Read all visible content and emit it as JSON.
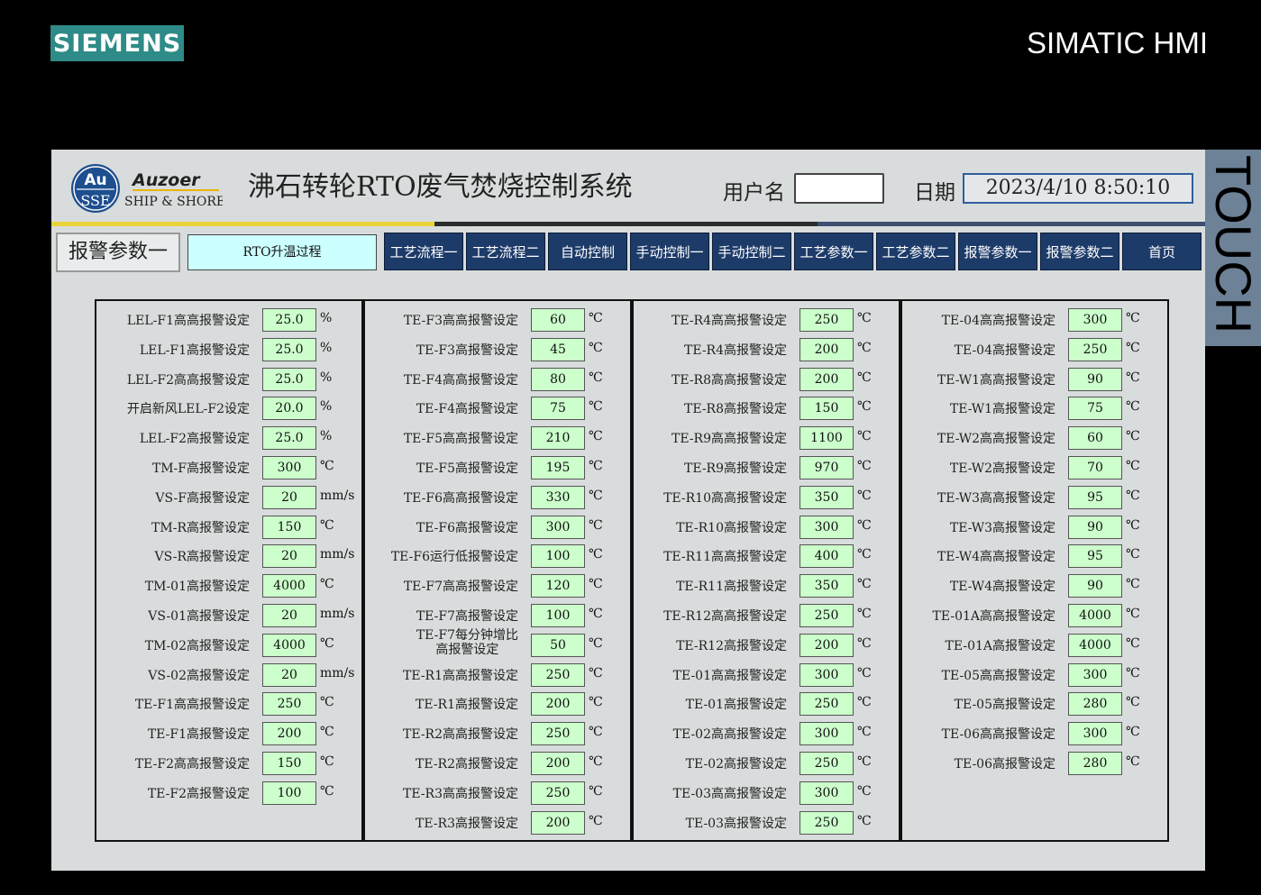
{
  "frame": {
    "brand": "SIEMENS",
    "product": "SIMATIC HMI",
    "touch_label": "TOUCH"
  },
  "logo": {
    "au": "Au",
    "sse": "SSE",
    "brand": "Auzoer",
    "sub": "SHIP & SHORE"
  },
  "header": {
    "title": "沸石转轮RTO废气焚烧控制系统",
    "user_label": "用户名",
    "user_value": "",
    "date_label": "日期",
    "datetime": "2023/4/10 8:50:10"
  },
  "page_label": "报警参数一",
  "stage": "RTO升温过程",
  "nav": [
    "工艺流程一",
    "工艺流程二",
    "自动控制",
    "手动控制一",
    "手动控制二",
    "工艺参数一",
    "工艺参数二",
    "报警参数一",
    "报警参数二",
    "首页"
  ],
  "columns": [
    [
      {
        "label": "LEL-F1高高报警设定",
        "value": "25.0",
        "unit": "%"
      },
      {
        "label": "LEL-F1高报警设定",
        "value": "25.0",
        "unit": "%"
      },
      {
        "label": "LEL-F2高高报警设定",
        "value": "25.0",
        "unit": "%"
      },
      {
        "label": "开启新风LEL-F2设定",
        "value": "20.0",
        "unit": "%"
      },
      {
        "label": "LEL-F2高报警设定",
        "value": "25.0",
        "unit": "%"
      },
      {
        "label": "TM-F高报警设定",
        "value": "300",
        "unit": "℃"
      },
      {
        "label": "VS-F高报警设定",
        "value": "20",
        "unit": "mm/s"
      },
      {
        "label": "TM-R高报警设定",
        "value": "150",
        "unit": "℃"
      },
      {
        "label": "VS-R高报警设定",
        "value": "20",
        "unit": "mm/s"
      },
      {
        "label": "TM-01高报警设定",
        "value": "4000",
        "unit": "℃"
      },
      {
        "label": "VS-01高报警设定",
        "value": "20",
        "unit": "mm/s"
      },
      {
        "label": "TM-02高报警设定",
        "value": "4000",
        "unit": "℃"
      },
      {
        "label": "VS-02高报警设定",
        "value": "20",
        "unit": "mm/s"
      },
      {
        "label": "TE-F1高高报警设定",
        "value": "250",
        "unit": "℃"
      },
      {
        "label": "TE-F1高报警设定",
        "value": "200",
        "unit": "℃"
      },
      {
        "label": "TE-F2高高报警设定",
        "value": "150",
        "unit": "℃"
      },
      {
        "label": "TE-F2高报警设定",
        "value": "100",
        "unit": "℃"
      }
    ],
    [
      {
        "label": "TE-F3高高报警设定",
        "value": "60",
        "unit": "℃"
      },
      {
        "label": "TE-F3高报警设定",
        "value": "45",
        "unit": "℃"
      },
      {
        "label": "TE-F4高高报警设定",
        "value": "80",
        "unit": "℃"
      },
      {
        "label": "TE-F4高报警设定",
        "value": "75",
        "unit": "℃"
      },
      {
        "label": "TE-F5高高报警设定",
        "value": "210",
        "unit": "℃"
      },
      {
        "label": "TE-F5高报警设定",
        "value": "195",
        "unit": "℃"
      },
      {
        "label": "TE-F6高高报警设定",
        "value": "330",
        "unit": "℃"
      },
      {
        "label": "TE-F6高报警设定",
        "value": "300",
        "unit": "℃"
      },
      {
        "label": "TE-F6运行低报警设定",
        "value": "100",
        "unit": "℃"
      },
      {
        "label": "TE-F7高高报警设定",
        "value": "120",
        "unit": "℃"
      },
      {
        "label": "TE-F7高报警设定",
        "value": "100",
        "unit": "℃"
      },
      {
        "label": "TE-F7每分钟增比\n高报警设定",
        "value": "50",
        "unit": "℃"
      },
      {
        "label": "TE-R1高高报警设定",
        "value": "250",
        "unit": "℃"
      },
      {
        "label": "TE-R1高报警设定",
        "value": "200",
        "unit": "℃"
      },
      {
        "label": "TE-R2高高报警设定",
        "value": "250",
        "unit": "℃"
      },
      {
        "label": "TE-R2高报警设定",
        "value": "200",
        "unit": "℃"
      },
      {
        "label": "TE-R3高高报警设定",
        "value": "250",
        "unit": "℃"
      },
      {
        "label": "TE-R3高报警设定",
        "value": "200",
        "unit": "℃"
      }
    ],
    [
      {
        "label": "TE-R4高高报警设定",
        "value": "250",
        "unit": "℃"
      },
      {
        "label": "TE-R4高报警设定",
        "value": "200",
        "unit": "℃"
      },
      {
        "label": "TE-R8高高报警设定",
        "value": "200",
        "unit": "℃"
      },
      {
        "label": "TE-R8高报警设定",
        "value": "150",
        "unit": "℃"
      },
      {
        "label": "TE-R9高高报警设定",
        "value": "1100",
        "unit": "℃"
      },
      {
        "label": "TE-R9高报警设定",
        "value": "970",
        "unit": "℃"
      },
      {
        "label": "TE-R10高高报警设定",
        "value": "350",
        "unit": "℃"
      },
      {
        "label": "TE-R10高报警设定",
        "value": "300",
        "unit": "℃"
      },
      {
        "label": "TE-R11高高报警设定",
        "value": "400",
        "unit": "℃"
      },
      {
        "label": "TE-R11高报警设定",
        "value": "350",
        "unit": "℃"
      },
      {
        "label": "TE-R12高高报警设定",
        "value": "250",
        "unit": "℃"
      },
      {
        "label": "TE-R12高报警设定",
        "value": "200",
        "unit": "℃"
      },
      {
        "label": "TE-01高高报警设定",
        "value": "300",
        "unit": "℃"
      },
      {
        "label": "TE-01高报警设定",
        "value": "250",
        "unit": "℃"
      },
      {
        "label": "TE-02高高报警设定",
        "value": "300",
        "unit": "℃"
      },
      {
        "label": "TE-02高报警设定",
        "value": "250",
        "unit": "℃"
      },
      {
        "label": "TE-03高高报警设定",
        "value": "300",
        "unit": "℃"
      },
      {
        "label": "TE-03高报警设定",
        "value": "250",
        "unit": "℃"
      }
    ],
    [
      {
        "label": "TE-04高高报警设定",
        "value": "300",
        "unit": "℃"
      },
      {
        "label": "TE-04高报警设定",
        "value": "250",
        "unit": "℃"
      },
      {
        "label": "TE-W1高高报警设定",
        "value": "90",
        "unit": "℃"
      },
      {
        "label": "TE-W1高报警设定",
        "value": "75",
        "unit": "℃"
      },
      {
        "label": "TE-W2高高报警设定",
        "value": "60",
        "unit": "℃"
      },
      {
        "label": "TE-W2高报警设定",
        "value": "70",
        "unit": "℃"
      },
      {
        "label": "TE-W3高高报警设定",
        "value": "95",
        "unit": "℃"
      },
      {
        "label": "TE-W3高报警设定",
        "value": "90",
        "unit": "℃"
      },
      {
        "label": "TE-W4高高报警设定",
        "value": "95",
        "unit": "℃"
      },
      {
        "label": "TE-W4高报警设定",
        "value": "90",
        "unit": "℃"
      },
      {
        "label": "TE-01A高高报警设定",
        "value": "4000",
        "unit": "℃"
      },
      {
        "label": "TE-01A高报警设定",
        "value": "4000",
        "unit": "℃"
      },
      {
        "label": "TE-05高高报警设定",
        "value": "300",
        "unit": "℃"
      },
      {
        "label": "TE-05高报警设定",
        "value": "280",
        "unit": "℃"
      },
      {
        "label": "TE-06高高报警设定",
        "value": "300",
        "unit": "℃"
      },
      {
        "label": "TE-06高报警设定",
        "value": "280",
        "unit": "℃"
      }
    ]
  ]
}
